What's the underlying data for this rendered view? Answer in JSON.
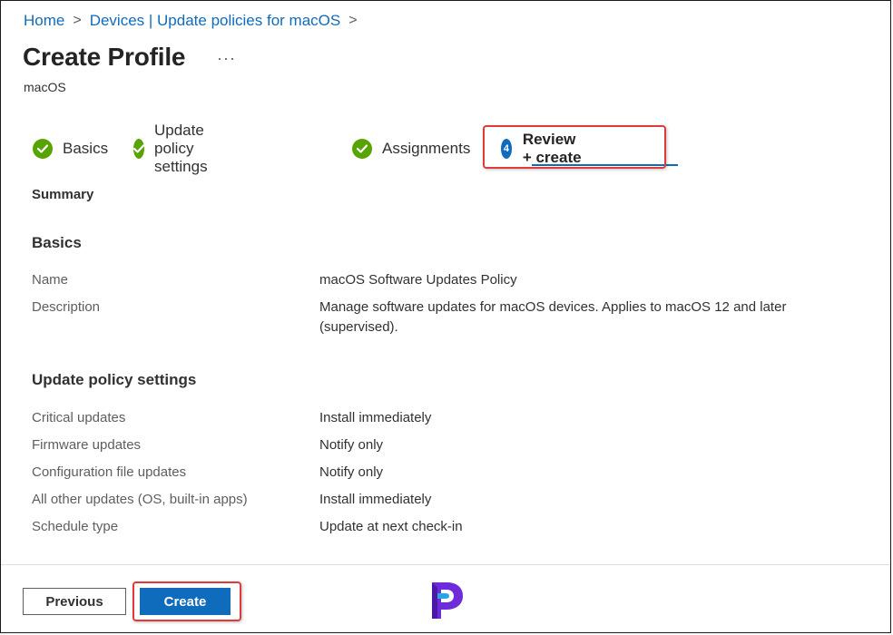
{
  "breadcrumb": {
    "items": [
      {
        "label": "Home"
      },
      {
        "label": "Devices | Update policies for macOS"
      }
    ],
    "separator": ">"
  },
  "header": {
    "title": "Create Profile",
    "more_label": "···",
    "subtitle": "macOS"
  },
  "wizard": {
    "steps": [
      {
        "label": "Basics",
        "status": "complete"
      },
      {
        "label": "Update policy settings",
        "status": "complete"
      },
      {
        "label": "Assignments",
        "status": "complete"
      },
      {
        "label": "Review + create",
        "status": "current",
        "number": "4"
      }
    ]
  },
  "summary": {
    "heading": "Summary",
    "basics": {
      "heading": "Basics",
      "rows": [
        {
          "label": "Name",
          "value": "macOS Software Updates Policy"
        },
        {
          "label": "Description",
          "value": "Manage software updates for macOS devices. Applies to macOS 12 and later (supervised)."
        }
      ]
    },
    "update_policy": {
      "heading": "Update policy settings",
      "rows": [
        {
          "label": "Critical updates",
          "value": "Install immediately"
        },
        {
          "label": "Firmware updates",
          "value": "Notify only"
        },
        {
          "label": "Configuration file updates",
          "value": "Notify only"
        },
        {
          "label": "All other updates (OS, built-in apps)",
          "value": "Install immediately"
        },
        {
          "label": "Schedule type",
          "value": "Update at next check-in"
        }
      ]
    }
  },
  "footer": {
    "previous_label": "Previous",
    "create_label": "Create"
  },
  "colors": {
    "accent": "#0f6cbd",
    "success": "#57a300",
    "highlight": "#e03b3b"
  },
  "icons": {
    "step_complete": "check-circle-icon",
    "more": "ellipsis-icon",
    "breadcrumb_separator": "chevron-right-icon",
    "watermark": "logo-icon"
  }
}
